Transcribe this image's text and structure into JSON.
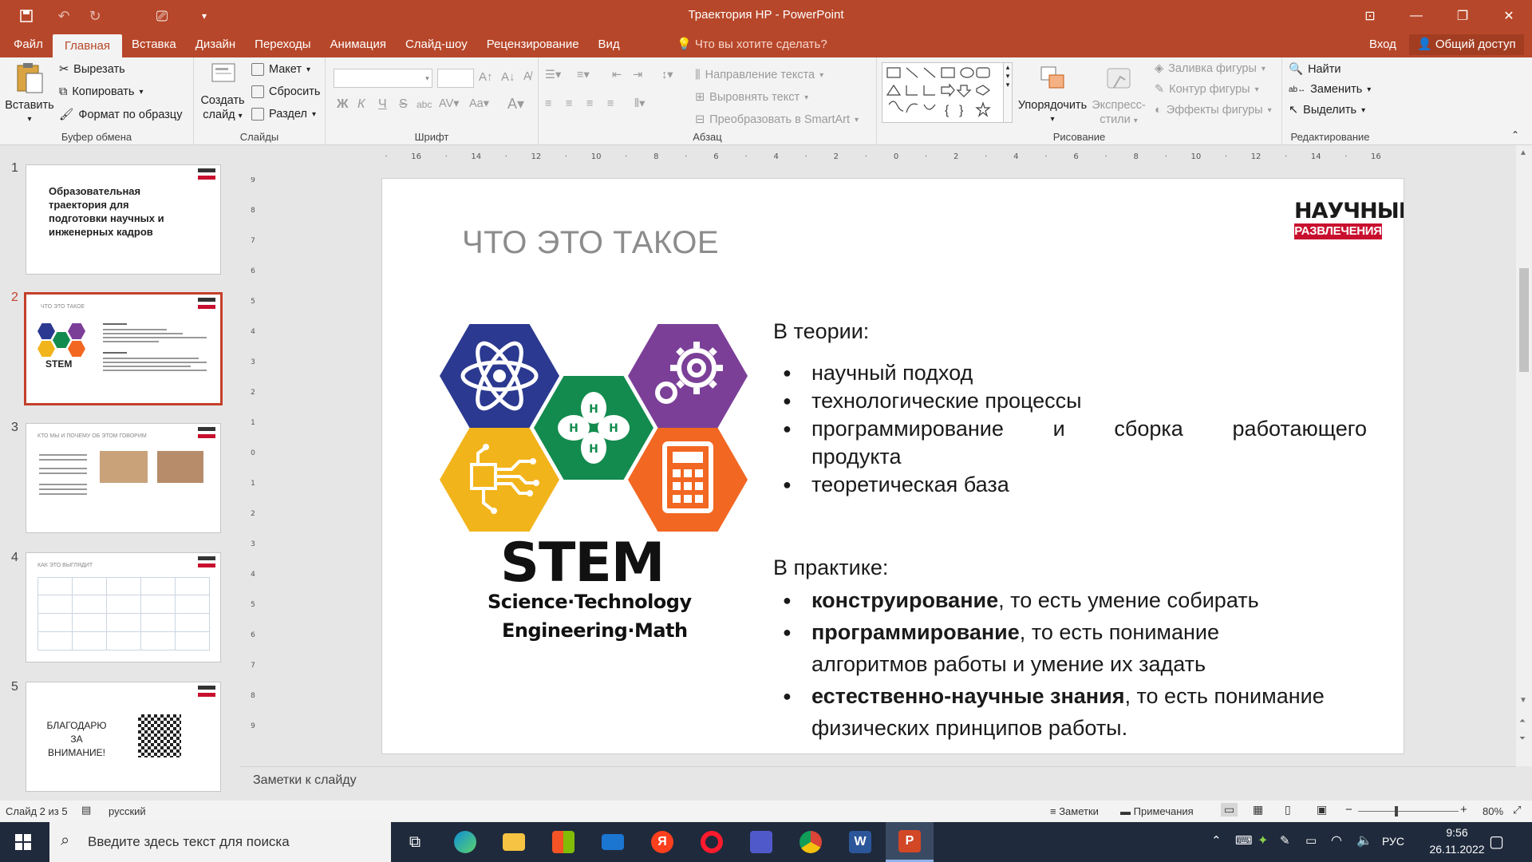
{
  "window": {
    "title": "Траектория НР - PowerPoint"
  },
  "tabs": [
    "Файл",
    "Главная",
    "Вставка",
    "Дизайн",
    "Переходы",
    "Анимация",
    "Слайд-шоу",
    "Рецензирование",
    "Вид"
  ],
  "tell_me": "Что вы хотите сделать?",
  "login": "Вход",
  "share": "Общий доступ",
  "ribbon": {
    "clipboard": {
      "paste": "Вставить",
      "cut": "Вырезать",
      "copy": "Копировать",
      "format_painter": "Формат по образцу",
      "label": "Буфер обмена"
    },
    "slides": {
      "new_slide_1": "Создать",
      "new_slide_2": "слайд",
      "layout": "Макет",
      "reset": "Сбросить",
      "section": "Раздел",
      "label": "Слайды"
    },
    "font": {
      "label": "Шрифт",
      "bold": "Ж",
      "italic": "К",
      "underline": "Ч",
      "strike": "S"
    },
    "paragraph": {
      "text_direction": "Направление текста",
      "align_text": "Выровнять текст",
      "smartart": "Преобразовать в SmartArt",
      "label": "Абзац"
    },
    "drawing": {
      "arrange": "Упорядочить",
      "quick_styles_1": "Экспресс-",
      "quick_styles_2": "стили",
      "fill": "Заливка фигуры",
      "outline": "Контур фигуры",
      "effects": "Эффекты фигуры",
      "label": "Рисование"
    },
    "editing": {
      "find": "Найти",
      "replace": "Заменить",
      "select": "Выделить",
      "label": "Редактирование"
    }
  },
  "thumbnails": [
    {
      "num": "1",
      "title": "Образовательная траектория для подготовки научных и инженерных кадров"
    },
    {
      "num": "2",
      "title": "ЧТО ЭТО ТАКОЕ"
    },
    {
      "num": "3",
      "title": "КТО МЫ И ПОЧЕМУ ОБ ЭТОМ ГОВОРИМ"
    },
    {
      "num": "4",
      "title": "КАК ЭТО ВЫГЛЯДИТ"
    },
    {
      "num": "5",
      "title": "БЛАГОДАРЮ ЗА ВНИМАНИЕ!"
    }
  ],
  "slide": {
    "title": "ЧТО ЭТО ТАКОЕ",
    "logo_top": "НАУЧНЫЕ",
    "logo_bottom": "РАЗВЛЕЧЕНИЯ",
    "stem": "STEM",
    "stem_line1": "Science·Technology",
    "stem_line2": "Engineering·Math",
    "theory_heading": "В теории:",
    "theory": [
      "научный подход",
      "технологические процессы",
      "программирование и сборка работающего продукта",
      "теоретическая база"
    ],
    "practice_heading": "В практике:",
    "practice": [
      {
        "bold": "конструирование",
        "rest": ", то есть умение собирать"
      },
      {
        "bold": "программирование",
        "rest": ", то есть понимание алгоритмов работы и умение их задать"
      },
      {
        "bold": "естественно-научные знания",
        "rest": ", то есть понимание физических принципов работы."
      }
    ]
  },
  "notes_placeholder": "Заметки к слайду",
  "status": {
    "slide": "Слайд 2 из 5",
    "lang": "русский",
    "notes": "Заметки",
    "comments": "Примечания",
    "zoom": "80%"
  },
  "taskbar": {
    "search": "Введите здесь текст для поиска",
    "lang": "РУС",
    "time": "9:56",
    "date": "26.11.2022"
  },
  "colors": {
    "accent": "#b7472a",
    "hex_blue": "#2b3990",
    "hex_purple": "#7b3f98",
    "hex_green": "#138b4e",
    "hex_yellow": "#f2b41b",
    "hex_orange": "#f26722"
  }
}
